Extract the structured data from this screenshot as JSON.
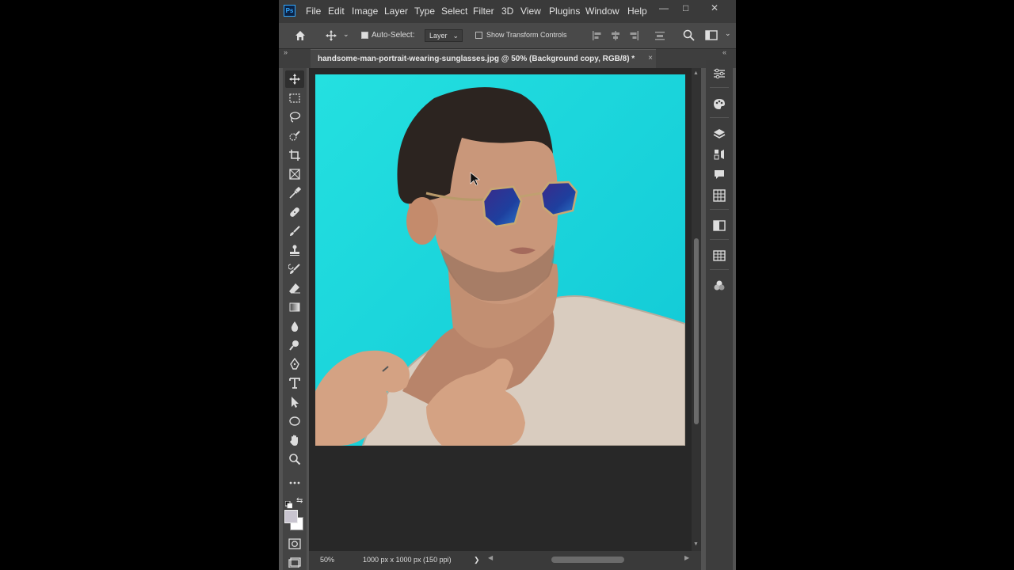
{
  "app": {
    "logo": "Ps",
    "accent": "#31a8ff"
  },
  "menu": [
    "File",
    "Edit",
    "Image",
    "Layer",
    "Type",
    "Select",
    "Filter",
    "3D",
    "View",
    "Plugins",
    "Window",
    "Help"
  ],
  "window_controls": {
    "minimize": "—",
    "maximize": "□",
    "close": "✕"
  },
  "options_bar": {
    "auto_select_label": "Auto-Select:",
    "auto_select_checked": true,
    "target_value": "Layer",
    "show_transform_label": "Show Transform Controls",
    "show_transform_checked": false
  },
  "document_tab": {
    "title": "handsome-man-portrait-wearing-sunglasses.jpg @ 50% (Background copy, RGB/8) *",
    "close": "×"
  },
  "tools": [
    "move-tool",
    "marquee-tool",
    "lasso-tool",
    "quick-select-tool",
    "crop-tool",
    "frame-tool",
    "eyedropper-tool",
    "healing-brush-tool",
    "brush-tool",
    "clone-stamp-tool",
    "history-brush-tool",
    "eraser-tool",
    "gradient-tool",
    "blur-tool",
    "dodge-tool",
    "pen-tool",
    "type-tool",
    "path-select-tool",
    "ellipse-tool",
    "hand-tool",
    "zoom-tool",
    "more-tools"
  ],
  "colors": {
    "foreground": "#c8c4cf",
    "background": "#ffffff",
    "photo_bg": "#1fd6d6"
  },
  "status": {
    "zoom": "50%",
    "doc_info": "1000 px x 1000 px (150 ppi)",
    "arrow": "❯"
  },
  "right_panels": [
    "adjustments-icon",
    "color-icon",
    "layers-icon",
    "channels-icon",
    "comments-icon",
    "swatches-icon",
    "gradients-icon",
    "patterns-icon",
    "libraries-icon"
  ]
}
